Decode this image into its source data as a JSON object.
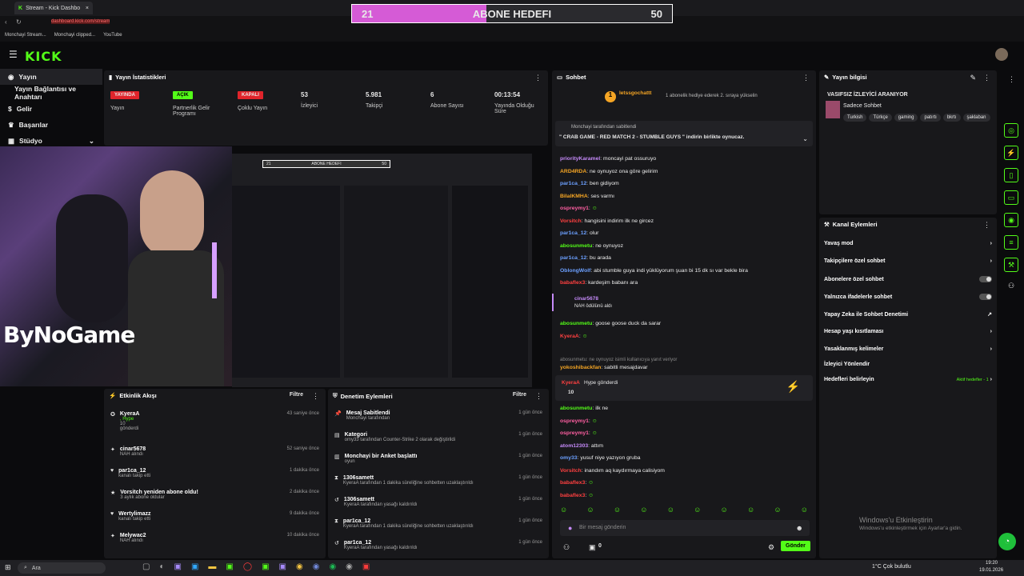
{
  "browser": {
    "tab_title": "Stream - Kick Dashbo",
    "address": "dashboard.kick.com/stream",
    "bookmarks": [
      "Monchayi Stream...",
      "Monchayi clipped...",
      "YouTube"
    ]
  },
  "goal": {
    "start": "21",
    "label": "ABONE HEDEFI",
    "end": "50",
    "progress": 0.42
  },
  "brand": {
    "logo": "KICK"
  },
  "sidebar": {
    "items": [
      "Yayın",
      "Yayın Bağlantısı ve Anahtarı",
      "Gelir",
      "Başarılar",
      "Stüdyo"
    ]
  },
  "stats": {
    "title": "Yayın İstatistikleri",
    "items": [
      {
        "badge": "YAYINDA",
        "label": "Yayın"
      },
      {
        "badge": "AÇIK",
        "label": "Partnerlik Gelir Programı"
      },
      {
        "badge": "KAPALI",
        "label": "Çoklu Yayın"
      },
      {
        "value": "53",
        "label": "İzleyici"
      },
      {
        "value": "5.981",
        "label": "Takipçi"
      },
      {
        "value": "6",
        "label": "Abone Sayısı"
      },
      {
        "value": "00:13:54",
        "label": "Yayında Olduğu Süre"
      }
    ]
  },
  "watermark": "ByNoGame",
  "preview": {
    "goal_start": "21",
    "goal_label": "ABONE HEDEFI",
    "goal_end": "50"
  },
  "activity": {
    "title": "Etkinlik Akışı",
    "filter": "Filtre",
    "rows": [
      {
        "title": "KyeraA",
        "sub": ", Hype",
        "sub2": "10",
        "sub3": "gönderdi",
        "time": "43 saniye önce"
      },
      {
        "title": "cinar5678",
        "sub": "NAH alındı",
        "time": "52 saniye önce"
      },
      {
        "title": "par1ca_12",
        "sub": "kanalı takip etti",
        "time": "1 dakika önce"
      },
      {
        "title": "Vorsitch yeniden abone oldu!",
        "sub": "3 aylık abone oldular",
        "time": "2 dakika önce"
      },
      {
        "title": "Wertylimazz",
        "sub": "kanalı takip etti",
        "time": "9 dakika önce"
      },
      {
        "title": "Melywac2",
        "sub": "NAH alındı",
        "time": "10 dakika önce"
      }
    ]
  },
  "moderation": {
    "title": "Denetim Eylemleri",
    "filter": "Filtre",
    "rows": [
      {
        "title": "Mesaj Sabitlendi",
        "sub": "Monchayi tarafından",
        "time": "1 gün önce"
      },
      {
        "title": "Kategori",
        "sub": "omy33 tarafından Counter-Strike 2 olarak değiştirildi",
        "time": "1 gün önce"
      },
      {
        "title": "Monchayi bir Anket başlattı",
        "sub": "oyun",
        "time": "1 gün önce"
      },
      {
        "title": "1306samett",
        "sub": "KyeraA tarafından 1 dakika süreliğine sohbetten uzaklaştırıldı",
        "time": "1 gün önce"
      },
      {
        "title": "1306samett",
        "sub": "KyeraA tarafından yasağı kaldırıldı",
        "time": "1 gün önce"
      },
      {
        "title": "par1ca_12",
        "sub": "KyeraA tarafından 1 dakika süreliğine sohbetten uzaklaştırıldı",
        "time": "1 gün önce"
      },
      {
        "title": "par1ca_12",
        "sub": "KyeraA tarafından yasağı kaldırıldı",
        "time": "1 gün önce"
      }
    ]
  },
  "chat": {
    "title": "Sohbet",
    "top_gifter": "letssgochattt",
    "gift_text": "1 abonelik hediye ederek 2. sıraya yükselin",
    "pinned_by": "Monchayi tarafından sabitlendi",
    "pinned_text": "\" CRAB GAME - RED MATCH 2 - STUMBLE GUYS \" indirin birlikte oynucaz.",
    "messages": [
      {
        "user": "priorityKaramel",
        "color": "#c58af9",
        "text": "moncayi pat ossuruyo"
      },
      {
        "user": "ARD4RDA",
        "color": "#f5a524",
        "text": "ne oynuyoz ona göre gelirim"
      },
      {
        "user": "par1ca_12",
        "color": "#6ca0ff",
        "text": "ben gidiyom"
      },
      {
        "user": "BilalKMHA",
        "color": "#f5a524",
        "text": "ses varmı"
      },
      {
        "user": "ospreymy1",
        "color": "#ff5fa2",
        "text": ""
      },
      {
        "user": "Vorsitch",
        "color": "#ff4040",
        "text": "hangisini indirim ilk ne gircez"
      },
      {
        "user": "par1ca_12",
        "color": "#6ca0ff",
        "text": "olur"
      },
      {
        "user": "abosunmetu",
        "color": "#53fc18",
        "text": "ne oynuyoz"
      },
      {
        "user": "par1ca_12",
        "color": "#6ca0ff",
        "text": "bu arada"
      },
      {
        "user": "OblongWolf",
        "color": "#6ca0ff",
        "text": "abi stumble guya indi yüklüyorum şuan bi 15 dk sı var bekle bira"
      },
      {
        "user": "babaflex3",
        "color": "#ff4040",
        "text": "kardeşim babanı ara"
      }
    ],
    "redeem_user": "cinar5678",
    "redeem_text": "NAH ödülünü aldı",
    "messages2": [
      {
        "user": "abosunmetu",
        "color": "#53fc18",
        "text": "goose goose duck da sarar"
      },
      {
        "user": "KyeraA",
        "color": "#ff4040",
        "text": ""
      }
    ],
    "reply_hint": "abosunmetu: ne oynuyoz isimli kullanıcıya yanıt veriyor",
    "pinned_notice_user": "yokoshibackfan",
    "pinned_notice": "sabitli mesajdavar",
    "hype_user": "KyeraA",
    "hype_text": "Hype gönderdi",
    "hype_amount": "10",
    "messages3": [
      {
        "user": "abosunmetu",
        "color": "#53fc18",
        "text": "ilk ne"
      },
      {
        "user": "ospreymy1",
        "color": "#ff5fa2",
        "text": ""
      },
      {
        "user": "ospreymy1",
        "color": "#ff5fa2",
        "text": ""
      },
      {
        "user": "atom12303",
        "color": "#c58af9",
        "text": "attım"
      },
      {
        "user": "omy33",
        "color": "#6ca0ff",
        "text": "yusuf niye yazıyon gruba"
      },
      {
        "user": "Vorsitch",
        "color": "#ff4040",
        "text": "inandım aq kaydırmaya calisiyom"
      },
      {
        "user": "babaflex3",
        "color": "#ff4040",
        "text": ""
      },
      {
        "user": "babaflex3",
        "color": "#ff4040",
        "text": ""
      }
    ],
    "input_placeholder": "Bir mesaj gönderin",
    "send": "Gönder",
    "count": "0"
  },
  "info": {
    "title": "Yayın bilgisi",
    "stream_title": "VASIFSIZ İZLEYİCİ ARANIYOR",
    "category": "Sadece Sohbet",
    "tags": [
      "Turkish",
      "Türkçe",
      "gaming",
      "patırtı",
      "bkrtı",
      "şaklaban"
    ]
  },
  "actions": {
    "title": "Kanal Eylemleri",
    "items": [
      "Yavaş mod",
      "Takipçilere özel sohbet",
      "Abonelere özel sohbet",
      "Yalnızca ifadelerle sohbet",
      "Yapay Zeka ile Sohbet Denetimi",
      "Hesap yaşı kısıtlaması",
      "Yasaklanmış kelimeler",
      "İzleyici Yönlendir",
      "Hedefleri belirleyin"
    ],
    "goals_hint": "Aktif hedefler - 1",
    "activate_title": "Windows'u Etkinleştirin",
    "activate_sub": "Windows'u etkinleştirmek için Ayarlar'a gidin."
  },
  "taskbar": {
    "search": "Ara",
    "weather": "1°C  Çok bulutlu",
    "time": "19:20",
    "date": "19.01.2026"
  }
}
